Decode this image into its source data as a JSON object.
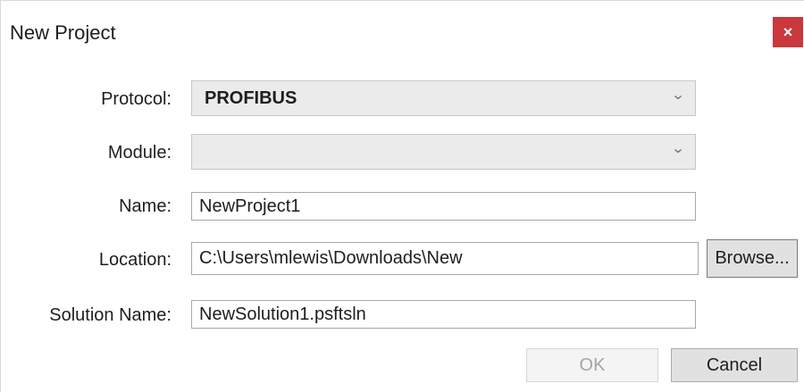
{
  "window": {
    "title": "New Project",
    "close_glyph": "×"
  },
  "form": {
    "protocol_label": "Protocol:",
    "protocol_value": "PROFIBUS",
    "module_label": "Module:",
    "module_value": "",
    "name_label": "Name:",
    "name_value": "NewProject1",
    "location_label": "Location:",
    "location_value": "C:\\Users\\mlewis\\Downloads\\New",
    "solution_label": "Solution Name:",
    "solution_value": "NewSolution1.psftsln"
  },
  "buttons": {
    "browse_label": "Browse...",
    "ok_label": "OK",
    "cancel_label": "Cancel"
  },
  "colors": {
    "close_bg": "#c9383c",
    "combo_bg": "#ebebeb",
    "disabled_text": "#a5a5a5"
  },
  "icons": {
    "close": "close-icon",
    "dropdown": "chevron-down-icon"
  }
}
